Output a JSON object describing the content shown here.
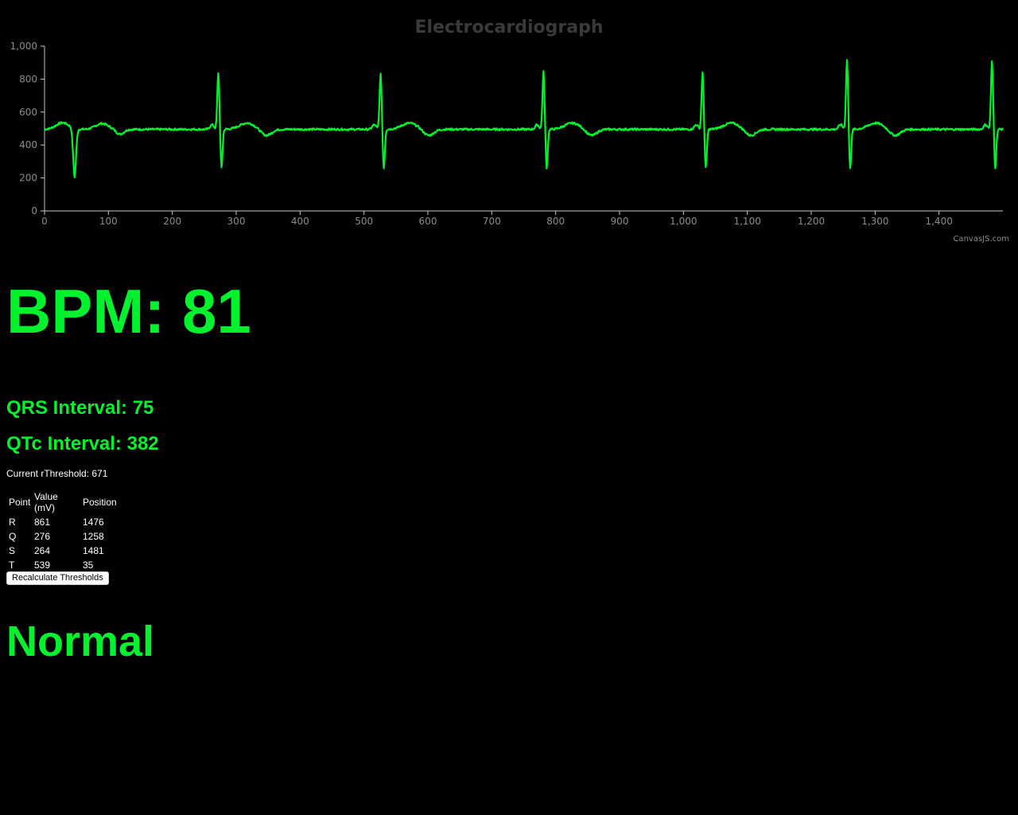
{
  "chart_data": {
    "type": "line",
    "title": "Electrocardiograph",
    "xlabel": "",
    "ylabel": "",
    "xlim": [
      0,
      1500
    ],
    "ylim": [
      0,
      1000
    ],
    "xticks": [
      0,
      100,
      200,
      300,
      400,
      500,
      600,
      700,
      800,
      900,
      1000,
      1100,
      1200,
      1300,
      1400
    ],
    "xtick_labels": [
      "0",
      "100",
      "200",
      "300",
      "400",
      "500",
      "600",
      "700",
      "800",
      "900",
      "1,000",
      "1,100",
      "1,200",
      "1,300",
      "1,400"
    ],
    "yticks": [
      0,
      200,
      400,
      600,
      800,
      1000
    ],
    "ytick_labels": [
      "0",
      "200",
      "400",
      "600",
      "800",
      "1,000"
    ],
    "grid": false,
    "line_color": "#00f22e",
    "credit": "CanvasJS.com",
    "beats": [
      {
        "peak_x": 272,
        "peak_y": 840
      },
      {
        "peak_x": 526,
        "peak_y": 830
      },
      {
        "peak_x": 781,
        "peak_y": 845
      },
      {
        "peak_x": 1030,
        "peak_y": 840
      },
      {
        "peak_x": 1256,
        "peak_y": 920
      },
      {
        "peak_x": 1483,
        "peak_y": 910
      }
    ],
    "initial_trough": {
      "x": 47,
      "y": 200
    },
    "baseline_y": 495
  },
  "bpm_text": "BPM: 81",
  "qrs_text": "QRS Interval: 75",
  "qtc_text": "QTc Interval: 382",
  "threshold_text": "Current rThreshold: 671",
  "table": {
    "headers": [
      "Point",
      "Value (mV)",
      "Position"
    ],
    "rows": [
      [
        "R",
        "861",
        "1476"
      ],
      [
        "Q",
        "276",
        "1258"
      ],
      [
        "S",
        "264",
        "1481"
      ],
      [
        "T",
        "539",
        "35"
      ]
    ]
  },
  "recalc_button_label": "Recalculate Thresholds",
  "status_text": "Normal",
  "colors": {
    "accent": "#00f22e",
    "background": "#000000",
    "text": "#ffffff"
  }
}
